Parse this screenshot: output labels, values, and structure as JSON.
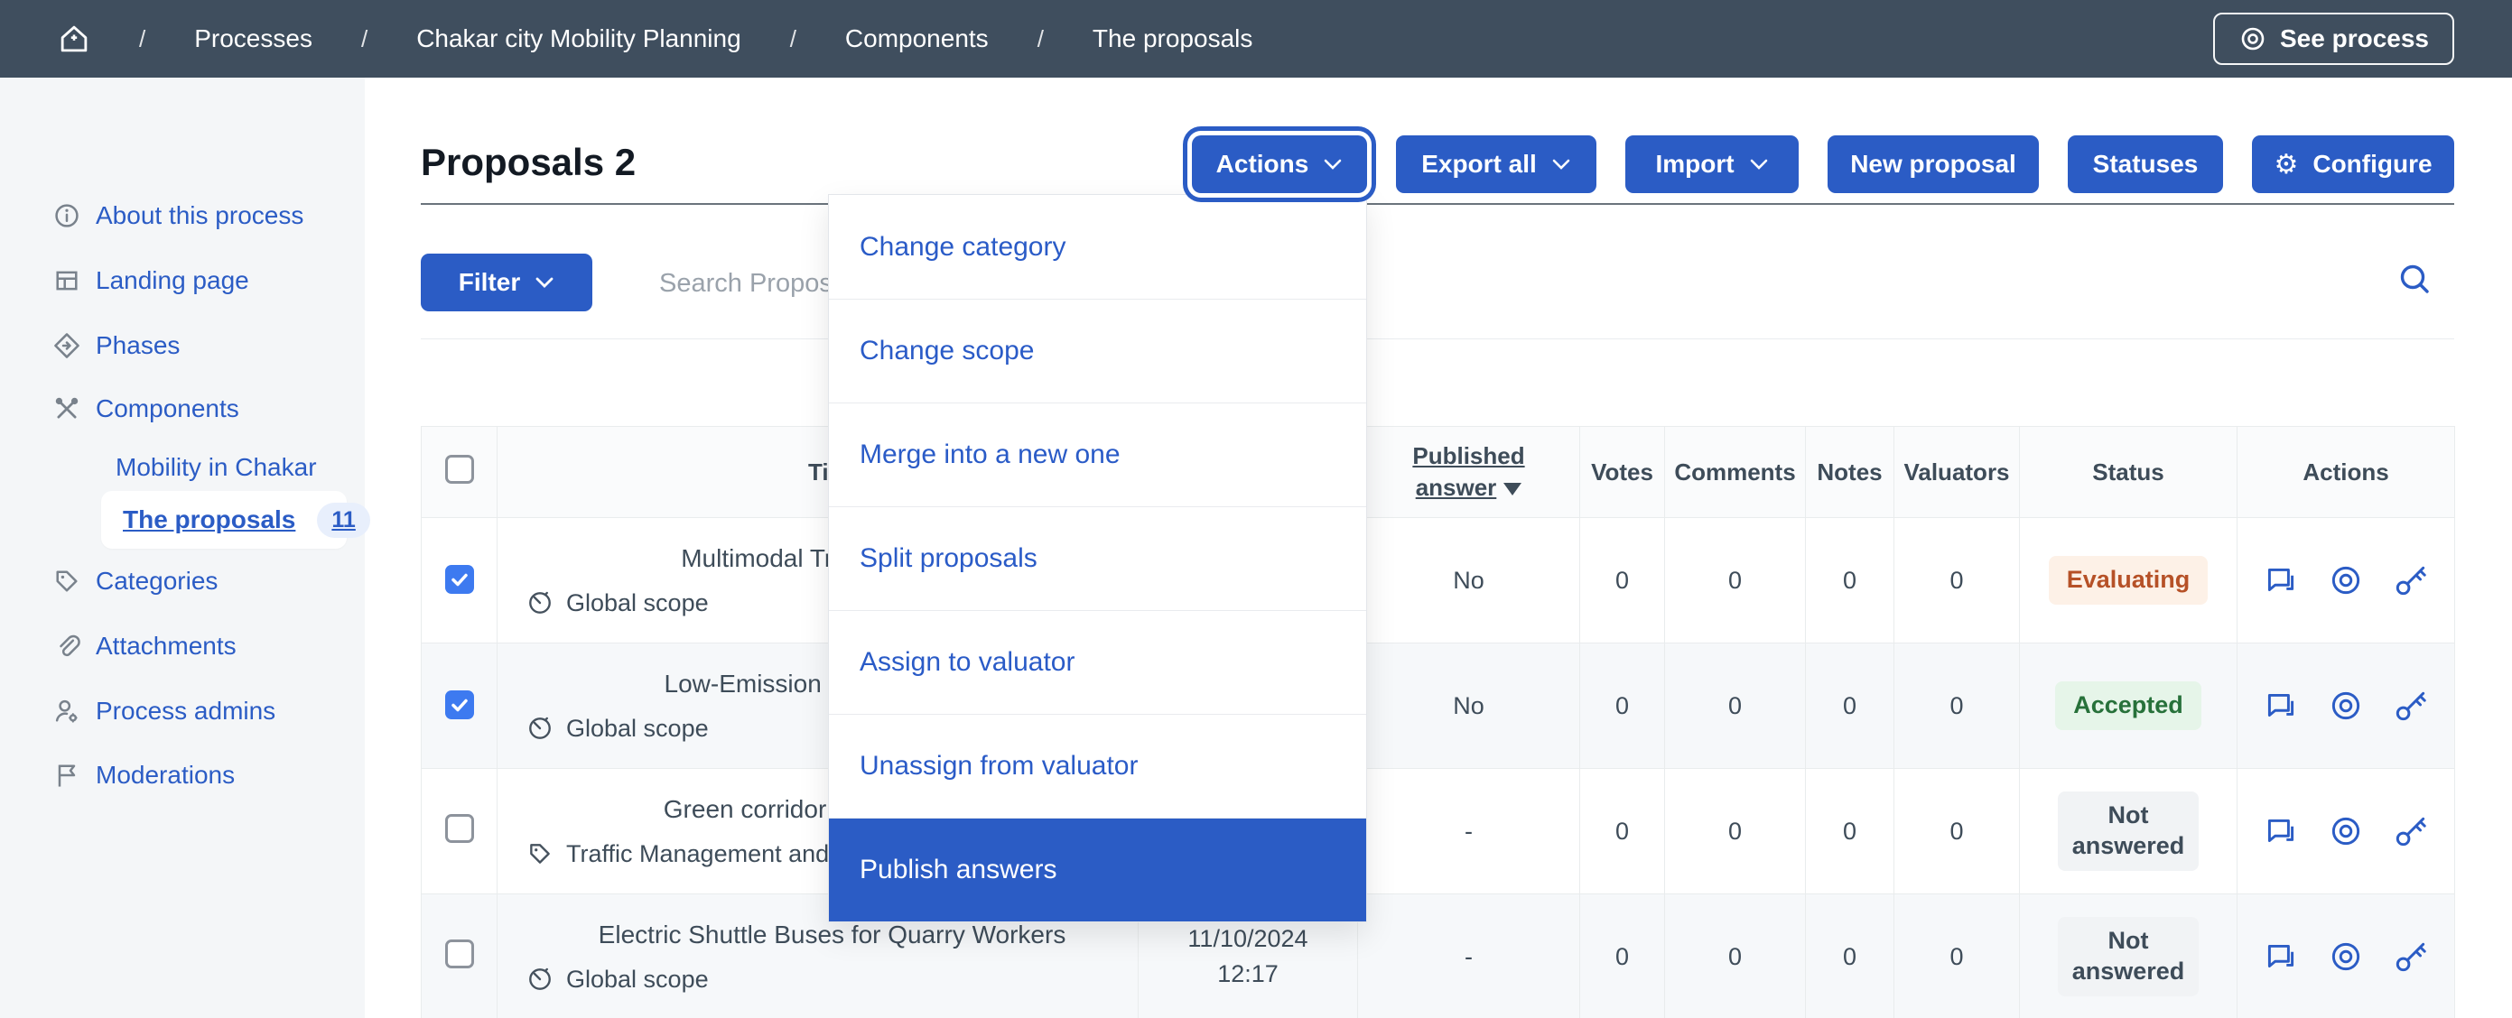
{
  "topbar": {
    "separator": "/",
    "breadcrumb": [
      "Processes",
      "Chakar city Mobility Planning",
      "Components",
      "The proposals"
    ],
    "see_process": "See process"
  },
  "sidebar": {
    "items": [
      {
        "label": "About this process"
      },
      {
        "label": "Landing page"
      },
      {
        "label": "Phases"
      },
      {
        "label": "Components"
      },
      {
        "label": "Mobility in Chakar"
      },
      {
        "label": "The proposals",
        "badge": "11"
      },
      {
        "label": "Categories"
      },
      {
        "label": "Attachments"
      },
      {
        "label": "Process admins"
      },
      {
        "label": "Moderations"
      }
    ]
  },
  "toolbar": {
    "title": "Proposals 2",
    "actions": "Actions",
    "export_all": "Export all",
    "import": "Import",
    "new_proposal": "New proposal",
    "statuses": "Statuses",
    "configure": "Configure"
  },
  "filters": {
    "filter": "Filter",
    "search_placeholder": "Search Proposals"
  },
  "dropdown": {
    "items": [
      "Change category",
      "Change scope",
      "Merge into a new one",
      "Split proposals",
      "Assign to valuator",
      "Unassign from valuator",
      "Publish answers"
    ],
    "active_item": "Publish answers"
  },
  "table": {
    "headers": {
      "title": "Title",
      "published_answer_line1": "Published",
      "published_answer_line2": "answer",
      "votes": "Votes",
      "comments": "Comments",
      "notes": "Notes",
      "valuators": "Valuators",
      "status": "Status",
      "actions": "Actions"
    },
    "rows": [
      {
        "title": "Multimodal Transport Hubs",
        "scope": "Global scope",
        "checked": true,
        "published_answer": "No",
        "votes": "0",
        "comments": "0",
        "notes": "0",
        "valuators": "0",
        "status": "Evaluating"
      },
      {
        "title": "Low-Emission Zones Around I",
        "scope": "Global scope",
        "checked": true,
        "published_answer": "No",
        "votes": "0",
        "comments": "0",
        "notes": "0",
        "valuators": "0",
        "status": "Accepted"
      },
      {
        "title": "Green corridor for cyclists and",
        "scope": "Traffic Management and S",
        "checked": false,
        "published_answer": "-",
        "votes": "0",
        "comments": "0",
        "notes": "0",
        "valuators": "0",
        "status": "Not answered"
      },
      {
        "title": "Electric Shuttle Buses for Quarry Workers",
        "scope": "Global scope",
        "checked": false,
        "published_date": "11/10/2024",
        "published_time": "12:17",
        "published_answer": "-",
        "votes": "0",
        "comments": "0",
        "notes": "0",
        "valuators": "0",
        "status": "Not answered"
      }
    ]
  },
  "colors": {
    "brand_blue": "#2b5cc5",
    "topbar_bg": "#3f4e5e",
    "evaluating_text": "#b65127",
    "evaluating_bg": "#fdf1e7",
    "accepted_text": "#27713a",
    "accepted_bg": "#e6f5e9",
    "neutral_text": "#3e4c59",
    "neutral_bg": "#f1f3f5",
    "checked_checkbox": "#3d7af0"
  }
}
